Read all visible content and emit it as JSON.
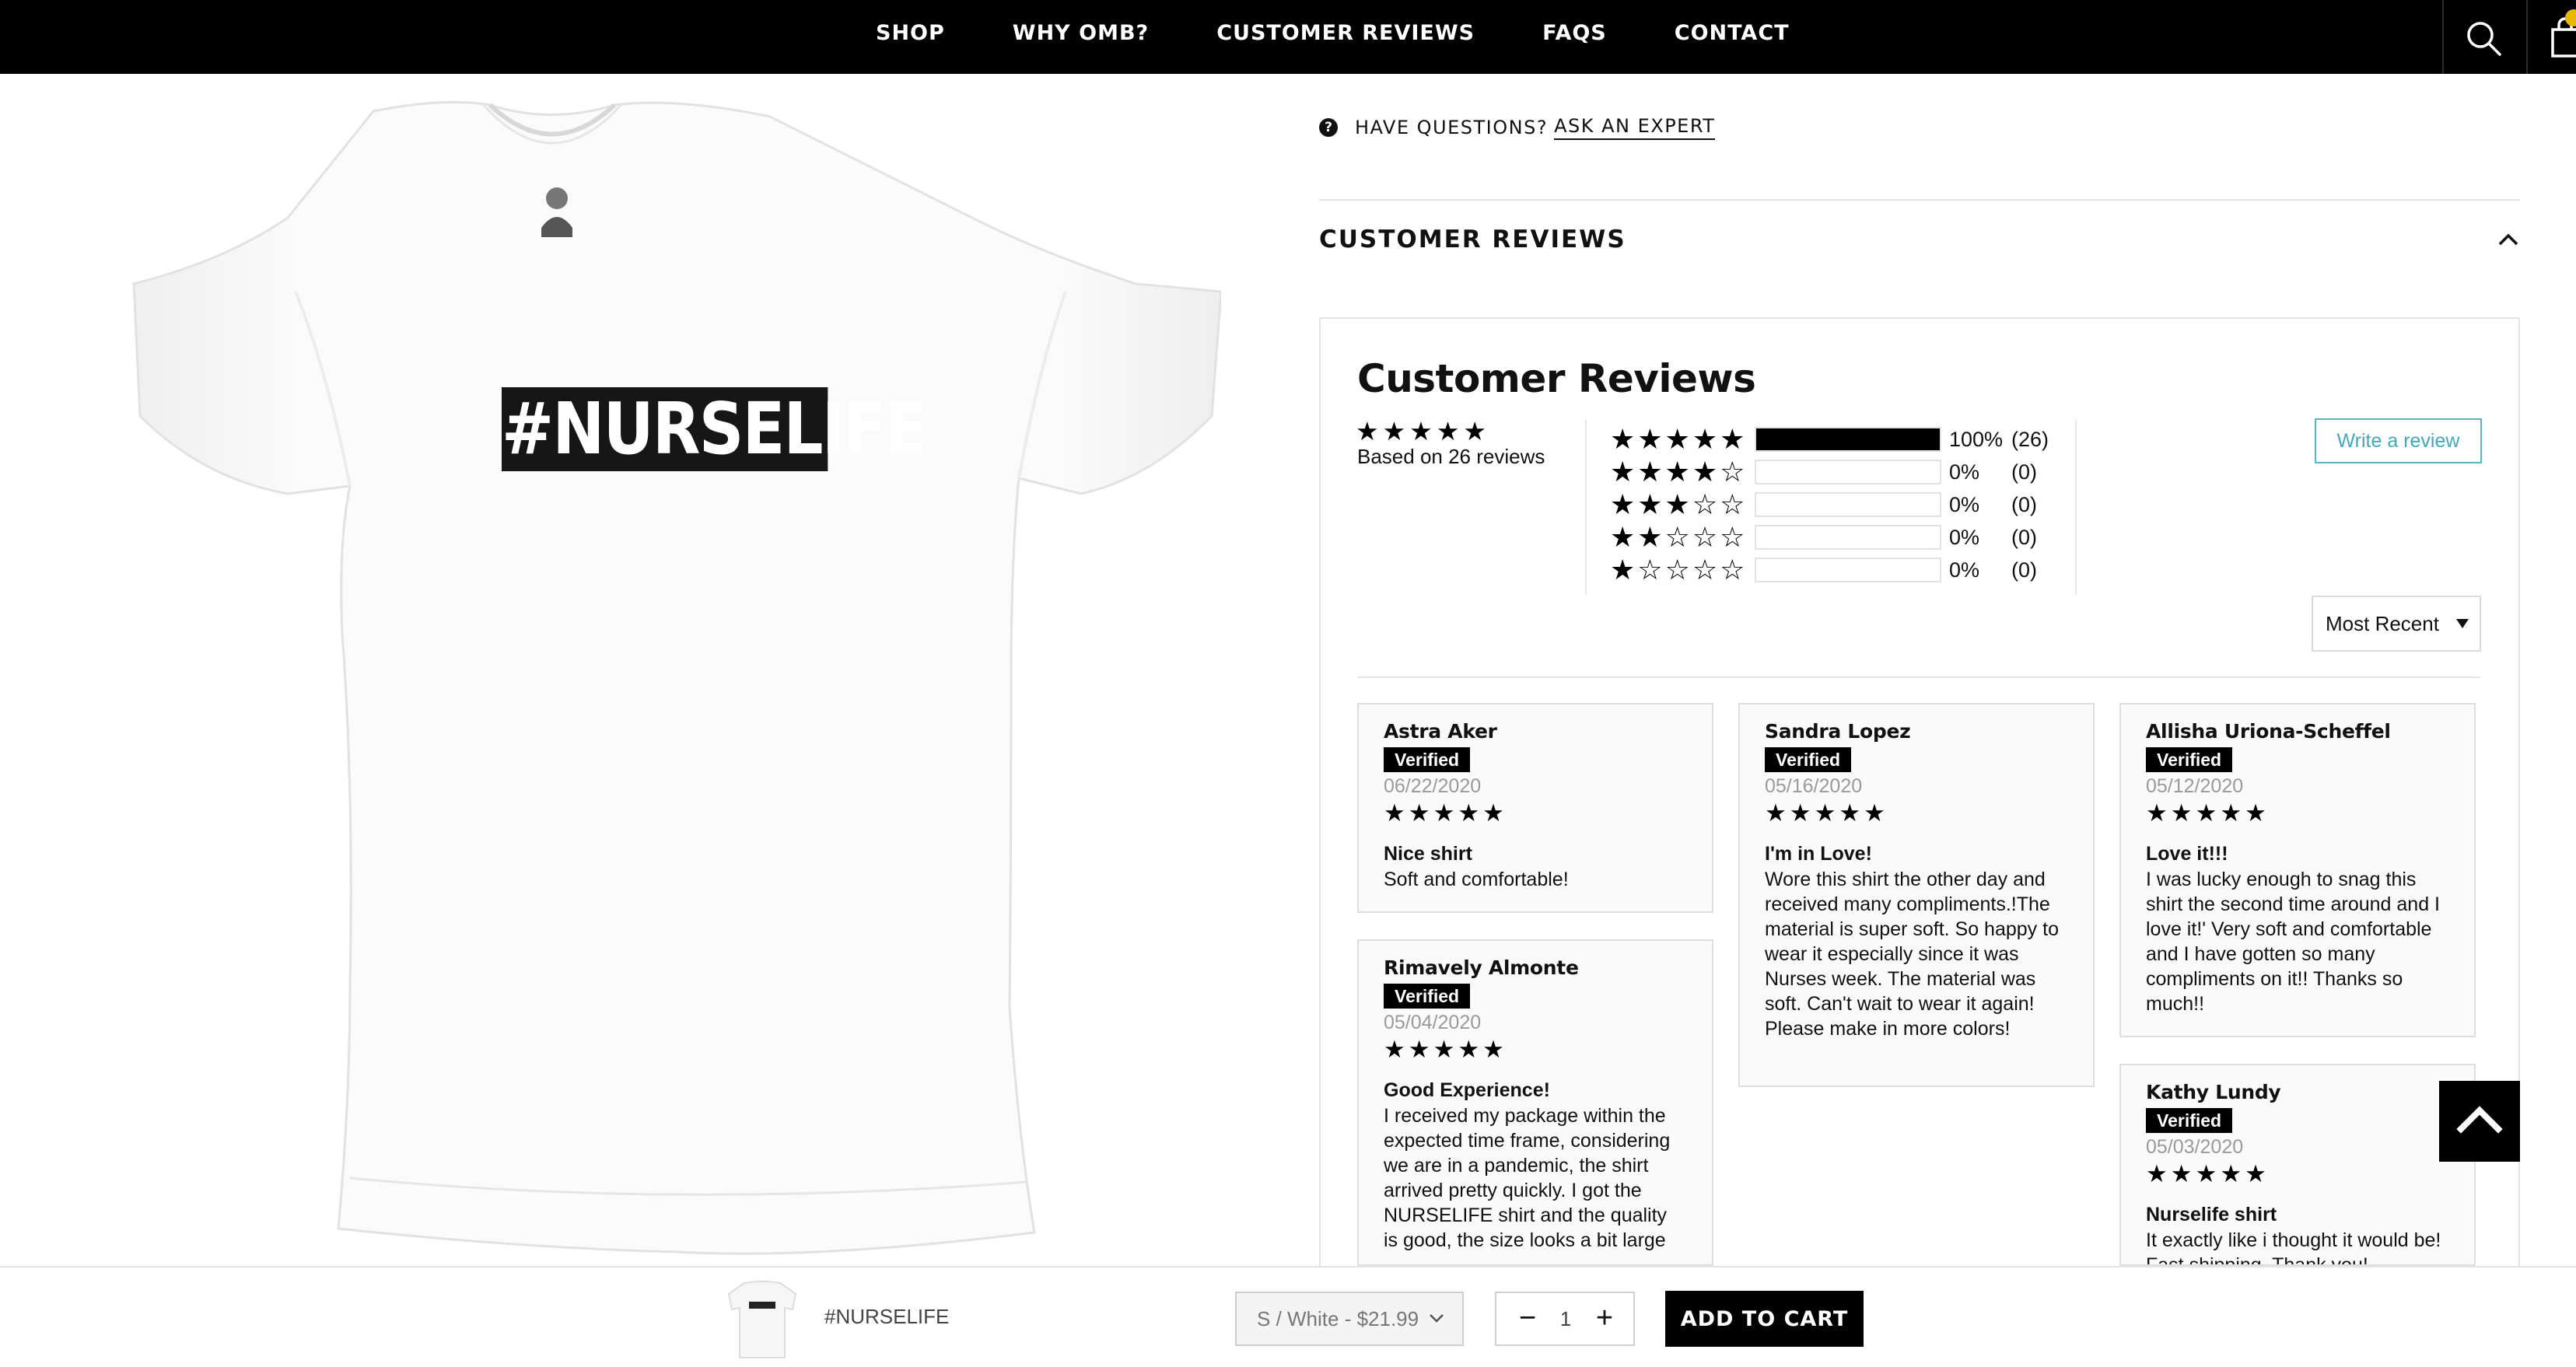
{
  "nav": {
    "items": [
      "SHOP",
      "WHY OMB?",
      "CUSTOMER REVIEWS",
      "FAQS",
      "CONTACT"
    ],
    "search_icon": "search-icon",
    "cart_icon": "shopping-bag-icon"
  },
  "product": {
    "print_text": "#NURSELIFE"
  },
  "questions": {
    "prefix": "HAVE QUESTIONS?",
    "link": "ASK AN EXPERT"
  },
  "reviews_section": {
    "title": "CUSTOMER REVIEWS"
  },
  "widget": {
    "title": "Customer Reviews",
    "summary_stars": "★★★★★",
    "based_on": "Based on 26 reviews",
    "histogram": [
      {
        "stars": "★★★★★",
        "fill": 1.0,
        "pct": "100%",
        "count": "(26)"
      },
      {
        "stars": "★★★★☆",
        "fill": 0,
        "pct": "0%",
        "count": "(0)"
      },
      {
        "stars": "★★★☆☆",
        "fill": 0,
        "pct": "0%",
        "count": "(0)"
      },
      {
        "stars": "★★☆☆☆",
        "fill": 0,
        "pct": "0%",
        "count": "(0)"
      },
      {
        "stars": "★☆☆☆☆",
        "fill": 0,
        "pct": "0%",
        "count": "(0)"
      }
    ],
    "write_review": "Write a review",
    "sort": "Most Recent"
  },
  "reviews": [
    {
      "name": "Astra Aker",
      "verified": "Verified",
      "date": "06/22/2020",
      "stars": "★★★★★",
      "title": "Nice shirt",
      "body": "Soft and comfortable!"
    },
    {
      "name": "Rimavely Almonte",
      "verified": "Verified",
      "date": "05/04/2020",
      "stars": "★★★★★",
      "title": "Good Experience!",
      "body": "I received my package within the expected time frame, considering we are in a pandemic, the shirt arrived pretty quickly. I got the NURSELIFE shirt and the quality is good, the size looks a bit large"
    },
    {
      "name": "Sandra Lopez",
      "verified": "Verified",
      "date": "05/16/2020",
      "stars": "★★★★★",
      "title": "I'm in Love!",
      "body": "Wore this shirt the other day and received many compliments.!The material is super soft. So happy to wear it especially since it was Nurses week. The material was soft. Can't wait to wear it again! Please make in more colors!"
    },
    {
      "name": "Allisha Uriona-Scheffel",
      "verified": "Verified",
      "date": "05/12/2020",
      "stars": "★★★★★",
      "title": "Love it!!!",
      "body": "I was lucky enough to snag this shirt the second time around and I love it!' Very soft and comfortable and I have gotten so many compliments on it!! Thanks so much!!"
    },
    {
      "name": "Kathy Lundy",
      "verified": "Verified",
      "date": "05/03/2020",
      "stars": "★★★★★",
      "title": "Nurselife shirt",
      "body": "It exactly like i thought it would be! Fast shipping. Thank you!"
    }
  ],
  "sticky_bar": {
    "product_name": "#NURSELIFE",
    "variant": "S / White - $21.99",
    "quantity": "1",
    "minus": "−",
    "plus": "+",
    "add_to_cart": "ADD TO CART"
  }
}
